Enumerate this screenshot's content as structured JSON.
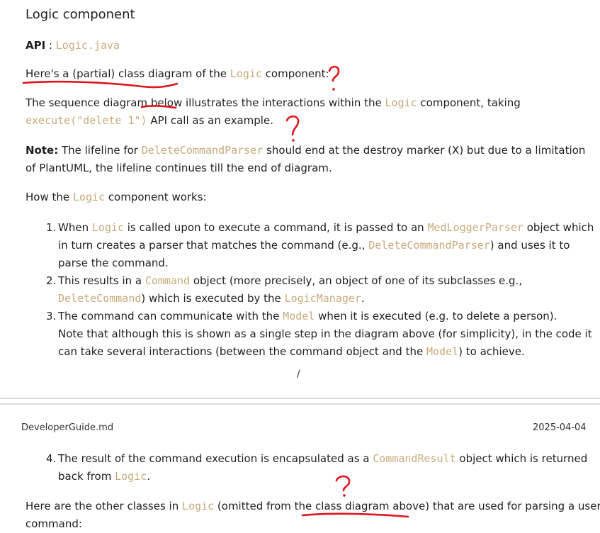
{
  "heading": "Logic component",
  "api_label": "API",
  "api_sep": " : ",
  "api_file": "Logic.java",
  "class_para": {
    "t1": "Here's a (partial) class diagram of the ",
    "c1": "Logic",
    "t2": " component:"
  },
  "seq_para": {
    "t1": "The sequence diagram below illustrates the interactions within the ",
    "c1": "Logic",
    "t2": " component, taking",
    "c2": "execute(\"delete 1\")",
    "t3": " API call as an example."
  },
  "note": {
    "label": "Note:",
    "t1": " The lifeline for ",
    "c1": "DeleteCommandParser",
    "t2": " should end at the destroy marker (X) but due to a limitation",
    "t3": "of PlantUML, the lifeline continues till the end of diagram."
  },
  "how": {
    "t1": "How the ",
    "c1": "Logic",
    "t2": " component works:"
  },
  "steps": [
    {
      "num": "1.",
      "l1a": "When ",
      "l1c": "Logic",
      "l1b": " is called upon to execute a command, it is passed to an ",
      "l1d": "MedLoggerParser",
      "l1e": " object which",
      "l2a": "in turn creates a parser that matches the command (e.g., ",
      "l2c": "DeleteCommandParser",
      "l2b": ") and uses it to",
      "l3": "parse the command."
    },
    {
      "num": "2.",
      "l1a": "This results in a ",
      "l1c": "Command",
      "l1b": " object (more precisely, an object of one of its subclasses e.g.,",
      "l2c": "DeleteCommand",
      "l2a": ") which is executed by the ",
      "l2d": "LogicManager",
      "l2b": "."
    },
    {
      "num": "3.",
      "l1a": "The command can communicate with the ",
      "l1c": "Model",
      "l1b": " when it is executed (e.g. to delete a person).",
      "l2": "Note that although this is shown as a single step in the diagram above (for simplicity), in the code it",
      "l3a": "can take several interactions (between the command object and the ",
      "l3c": "Model",
      "l3b": ") to achieve."
    }
  ],
  "page_mark": "/",
  "footer": {
    "file": "DeveloperGuide.md",
    "date": "2025-04-04"
  },
  "step4": {
    "num": "4.",
    "l1a": "The result of the command execution is encapsulated as a ",
    "l1c": "CommandResult",
    "l1b": " object which is returned",
    "l2a": "back from ",
    "l2c": "Logic",
    "l2b": "."
  },
  "other_para": {
    "t1": "Here are the other classes in ",
    "c1": "Logic",
    "t2": " (omitted from the class diagram above) that are used for parsing a user",
    "t3": "command:"
  },
  "annotation_color": "#e0141e",
  "code_color": "#c9a97a"
}
